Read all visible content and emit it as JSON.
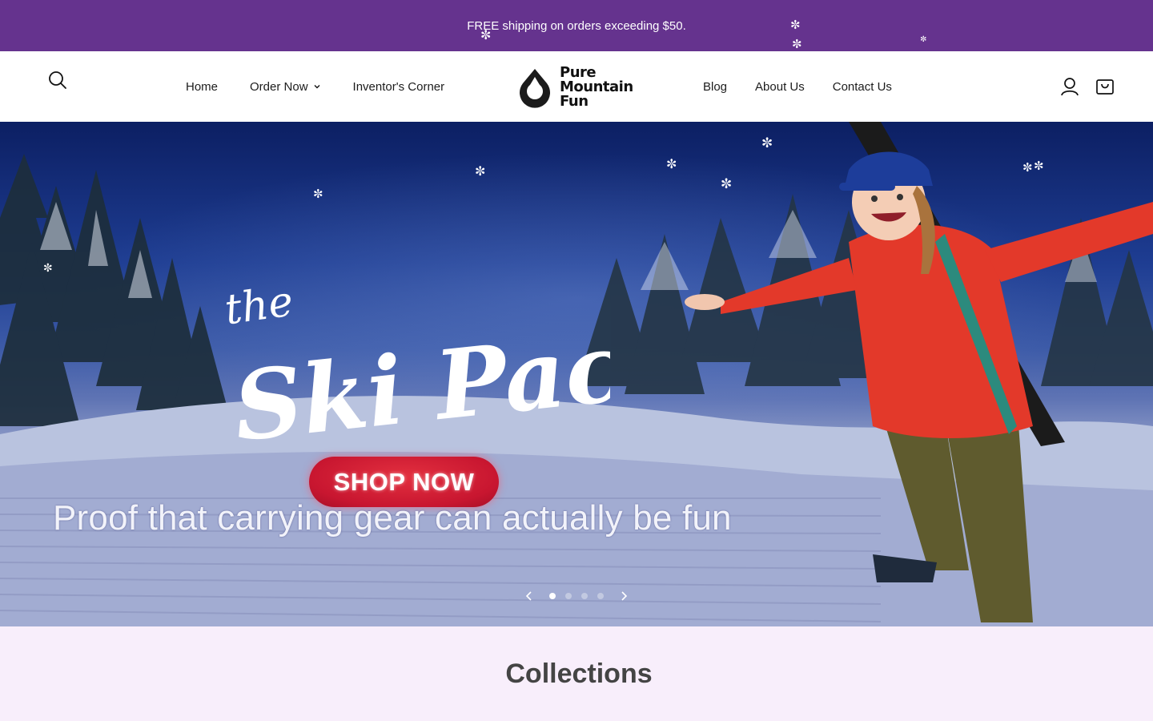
{
  "announcement": {
    "text": "FREE shipping on orders exceeding $50."
  },
  "header": {
    "nav_left": [
      {
        "label": "Home"
      },
      {
        "label": "Order Now",
        "has_dropdown": true
      },
      {
        "label": "Inventor's Corner"
      }
    ],
    "logo": {
      "line1": "Pure",
      "line2": "Mountain",
      "line3": "Fun"
    },
    "nav_right": [
      {
        "label": "Blog"
      },
      {
        "label": "About Us"
      },
      {
        "label": "Contact Us"
      }
    ],
    "icons": [
      "search-icon",
      "account-icon",
      "cart-icon"
    ]
  },
  "hero": {
    "script_small": "the",
    "script_large": "Ski Pack:",
    "cta_label": "SHOP NOW",
    "tagline": "Proof that carrying gear can actually be fun",
    "slides_count": 4,
    "active_slide": 1
  },
  "collections": {
    "title": "Collections"
  },
  "colors": {
    "announcement_bg": "#65338e",
    "header_bg": "#ffffff",
    "cta_red": "#c81630",
    "section_bg": "#f8eefb"
  }
}
